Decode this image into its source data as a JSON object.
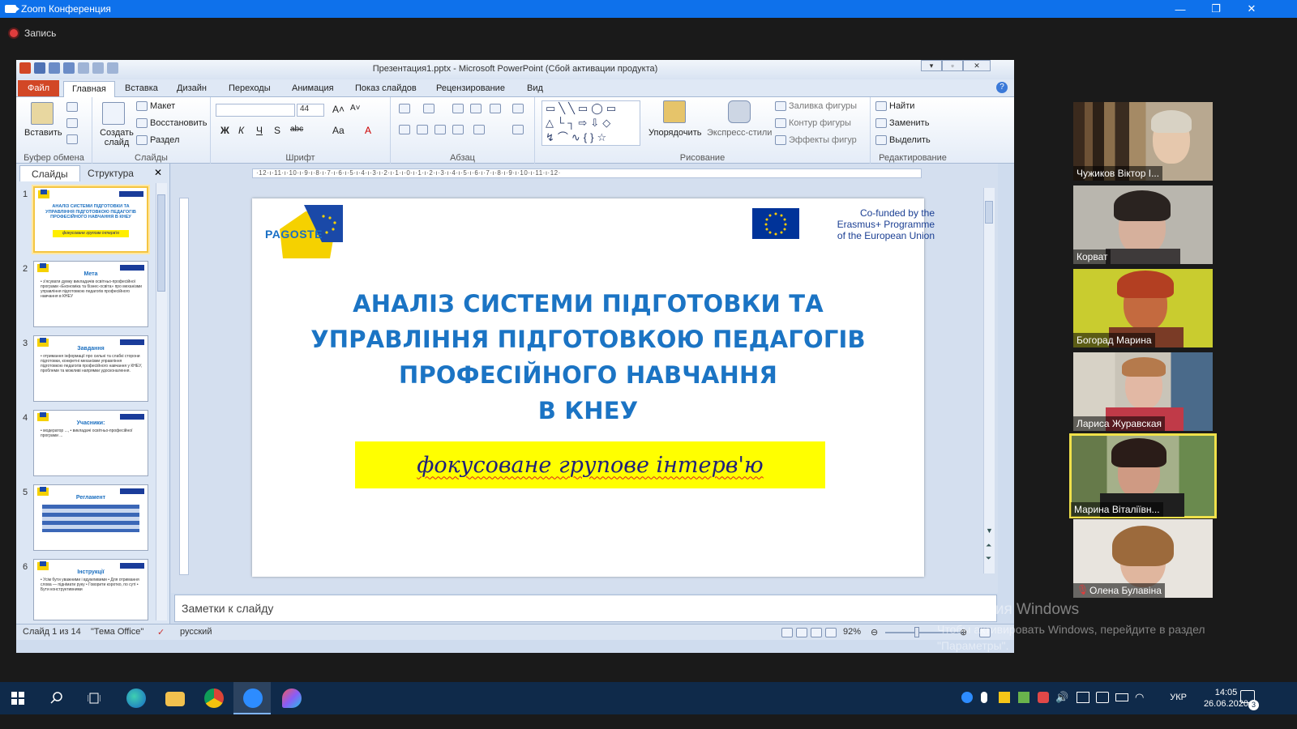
{
  "zoom": {
    "window_title": "Zoom Конференция",
    "recording_label": "Запись",
    "minimize": "—",
    "maximize": "❐",
    "close": "✕"
  },
  "ppt": {
    "title": "Презентация1.pptx - Microsoft PowerPoint (Сбой активации продукта)",
    "tabs": [
      "Файл",
      "Главная",
      "Вставка",
      "Дизайн",
      "Переходы",
      "Анимация",
      "Показ слайдов",
      "Рецензирование",
      "Вид"
    ],
    "ribbon": {
      "clipboard": {
        "label": "Буфер обмена",
        "paste": "Вставить"
      },
      "slides": {
        "label": "Слайды",
        "new_slide": "Создать слайд",
        "layout": "Макет",
        "reset": "Восстановить",
        "section": "Раздел"
      },
      "font": {
        "label": "Шрифт",
        "size": "44"
      },
      "paragraph": {
        "label": "Абзац"
      },
      "drawing": {
        "label": "Рисование",
        "arrange": "Упорядочить",
        "quick_styles": "Экспресс-стили",
        "fill": "Заливка фигуры",
        "outline": "Контур фигуры",
        "effects": "Эффекты фигур"
      },
      "editing": {
        "label": "Редактирование",
        "find": "Найти",
        "replace": "Заменить",
        "select": "Выделить"
      }
    },
    "panel_tabs": {
      "slides": "Слайды",
      "outline": "Структура",
      "close": "✕"
    },
    "thumbnails": [
      {
        "num": "1",
        "title": "АНАЛІЗ СИСТЕМИ ПІДГОТОВКИ ТА УПРАВЛІННЯ ПІДГОТОВКОЮ ПЕДАГОГІВ ПРОФЕСІЙНОГО НАВЧАННЯ В КНЕУ",
        "sub": "фокусоване групове інтерв'ю"
      },
      {
        "num": "2",
        "title": "Мета",
        "text": "• з'ясувати думку викладачів освітньо-професійної програми «Економіка та бізнес-освіта» про механізми управління підготовкою педагогів професійного навчання в КНЕУ"
      },
      {
        "num": "3",
        "title": "Завдання",
        "text": "• отримання інформації про сильні та слабкі сторони підготовки, конкретні механізми управління підготовкою педагогів професійного навчання у КНЕУ, проблеми та можливі напрямки удосконалення."
      },
      {
        "num": "4",
        "title": "Учасники:",
        "text": "• модератор ..., • викладачі освітньо-професійної програми ..."
      },
      {
        "num": "5",
        "title": "Регламент",
        "text": ""
      },
      {
        "num": "6",
        "title": "Інструкції",
        "text": "• Усім бути уважними і вдумливими • Для отримання слова — піднімати руку • Говорити коротко, по суті • Бути конструктивними"
      }
    ],
    "slide": {
      "pagoste": "PAGOSTE",
      "eu_text_1": "Co-funded by the",
      "eu_text_2": "Erasmus+ Programme",
      "eu_text_3": "of the European Union",
      "title_1": "АНАЛІЗ СИСТЕМИ ПІДГОТОВКИ ТА",
      "title_2": "УПРАВЛІННЯ ПІДГОТОВКОЮ ПЕДАГОГІВ",
      "title_3": "ПРОФЕСІЙНОГО НАВЧАННЯ",
      "title_4": "В КНЕУ",
      "subtitle": "фокусоване групове інтерв'ю"
    },
    "notes_placeholder": "Заметки к слайду",
    "status": {
      "slide_pos": "Слайд 1 из 14",
      "theme": "\"Тема Office\"",
      "language": "русский",
      "zoom": "92%"
    }
  },
  "participants": [
    {
      "name": "Чужиков Віктор І..."
    },
    {
      "name": "Корват"
    },
    {
      "name": "Богорад Марина"
    },
    {
      "name": "Лариса Журавская"
    },
    {
      "name": "Марина Віталіївн..."
    },
    {
      "name": "Олена Булавіна"
    }
  ],
  "windows": {
    "activation_title": "Активация Windows",
    "activation_text": "Чтобы активировать Windows, перейдите в раздел \"Параметры\".",
    "language": "УКР",
    "time": "14:05",
    "date": "26.06.2020",
    "notifications": "3"
  }
}
